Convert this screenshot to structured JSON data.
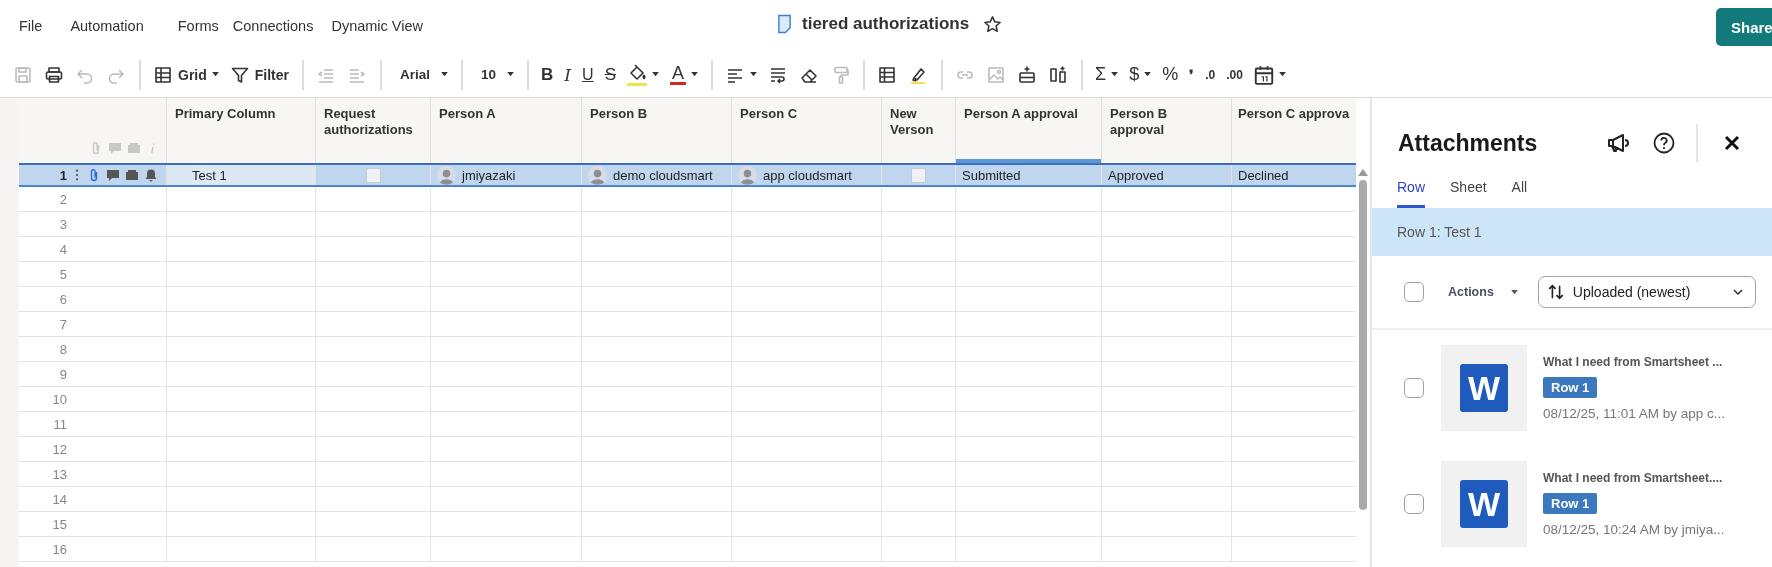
{
  "menu": [
    "File",
    "Automation",
    "Forms",
    "Connections",
    "Dynamic View"
  ],
  "sheet": {
    "title": "tiered authorizations",
    "starred": false
  },
  "share_button": "Share",
  "toolbar": [
    {
      "kind": "save",
      "disabled": true
    },
    {
      "kind": "print",
      "disabled": false
    },
    {
      "kind": "undo",
      "disabled": true
    },
    {
      "kind": "redo",
      "disabled": true
    },
    {
      "kind": "separator"
    },
    {
      "kind": "view",
      "label": "Grid",
      "caret": true
    },
    {
      "kind": "filter",
      "label": "Filter"
    },
    {
      "kind": "separator"
    },
    {
      "kind": "outdent",
      "disabled": true
    },
    {
      "kind": "indent",
      "disabled": true
    },
    {
      "kind": "separator"
    },
    {
      "kind": "font",
      "label": "Arial",
      "caret": true
    },
    {
      "kind": "separator"
    },
    {
      "kind": "size",
      "label": "10",
      "caret": true
    },
    {
      "kind": "separator"
    },
    {
      "kind": "bold",
      "label": "B"
    },
    {
      "kind": "italic",
      "label": "I"
    },
    {
      "kind": "underline",
      "label": "U"
    },
    {
      "kind": "strike",
      "label": "S"
    },
    {
      "kind": "fill",
      "caret": true
    },
    {
      "kind": "textcolor",
      "label": "A",
      "caret": true
    },
    {
      "kind": "separator"
    },
    {
      "kind": "align",
      "caret": true
    },
    {
      "kind": "wrap",
      "disabled": false
    },
    {
      "kind": "eraser",
      "disabled": false
    },
    {
      "kind": "paint",
      "disabled": true
    },
    {
      "kind": "separator"
    },
    {
      "kind": "table",
      "disabled": false
    },
    {
      "kind": "highlight",
      "disabled": false
    },
    {
      "kind": "separator"
    },
    {
      "kind": "link",
      "disabled": true
    },
    {
      "kind": "image",
      "disabled": true
    },
    {
      "kind": "insertrow",
      "disabled": false
    },
    {
      "kind": "columns",
      "disabled": false
    },
    {
      "kind": "separator"
    },
    {
      "kind": "sum",
      "label": "Σ",
      "caret": true
    },
    {
      "kind": "currency",
      "label": "$",
      "caret": true
    },
    {
      "kind": "percent",
      "label": "%"
    },
    {
      "kind": "comma",
      "label": "❜"
    },
    {
      "kind": "decdown",
      "label": ".0"
    },
    {
      "kind": "decup",
      "label": ".00"
    },
    {
      "kind": "date",
      "caret": true
    }
  ],
  "grid": {
    "columns": [
      {
        "label": "Primary Column",
        "highlighted": false
      },
      {
        "label": "Request authorizations",
        "highlighted": false
      },
      {
        "label": "Person A",
        "highlighted": false
      },
      {
        "label": "Person B",
        "highlighted": false
      },
      {
        "label": "Person C",
        "highlighted": false
      },
      {
        "label": "New Verson",
        "highlighted": false
      },
      {
        "label": "Person A approval",
        "highlighted": true
      },
      {
        "label": "Person B approval",
        "highlighted": false
      },
      {
        "label": "Person C approva",
        "highlighted": false
      }
    ],
    "rows": [
      {
        "number": "1",
        "selected": true,
        "has_attachments": true,
        "cells": [
          {
            "kind": "text",
            "value": "Test 1"
          },
          {
            "kind": "checkbox",
            "checked": false
          },
          {
            "kind": "contact",
            "value": "jmiyazaki"
          },
          {
            "kind": "contact",
            "value": "demo cloudsmart"
          },
          {
            "kind": "contact",
            "value": "app cloudsmart"
          },
          {
            "kind": "checkbox",
            "checked": false
          },
          {
            "kind": "text",
            "value": "Submitted"
          },
          {
            "kind": "text",
            "value": "Approved"
          },
          {
            "kind": "text",
            "value": "Declined"
          }
        ]
      },
      {
        "number": "2",
        "selected": false
      },
      {
        "number": "3",
        "selected": false
      },
      {
        "number": "4",
        "selected": false
      },
      {
        "number": "5",
        "selected": false
      },
      {
        "number": "6",
        "selected": false
      },
      {
        "number": "7",
        "selected": false
      },
      {
        "number": "8",
        "selected": false
      },
      {
        "number": "9",
        "selected": false
      },
      {
        "number": "10",
        "selected": false
      },
      {
        "number": "11",
        "selected": false
      },
      {
        "number": "12",
        "selected": false
      },
      {
        "number": "13",
        "selected": false
      },
      {
        "number": "14",
        "selected": false
      },
      {
        "number": "15",
        "selected": false
      },
      {
        "number": "16",
        "selected": false
      }
    ]
  },
  "panel": {
    "title": "Attachments",
    "tabs": [
      {
        "label": "Row",
        "selected": true
      },
      {
        "label": "Sheet",
        "selected": false
      },
      {
        "label": "All",
        "selected": false
      }
    ],
    "context": "Row 1: Test 1",
    "select_all": {
      "checked": false
    },
    "actions": "Actions",
    "sort": "Uploaded (newest)",
    "items": [
      {
        "icon_label": "W",
        "name": "What I need from Smartsheet ...",
        "tag": "Row 1",
        "meta": "08/12/25, 11:01 AM by app c...",
        "checked": false
      },
      {
        "icon_label": "W",
        "name": "What I need from Smartsheet....",
        "tag": "Row 1",
        "meta": "08/12/25, 10:24 AM by jmiya...",
        "checked": false
      }
    ]
  }
}
